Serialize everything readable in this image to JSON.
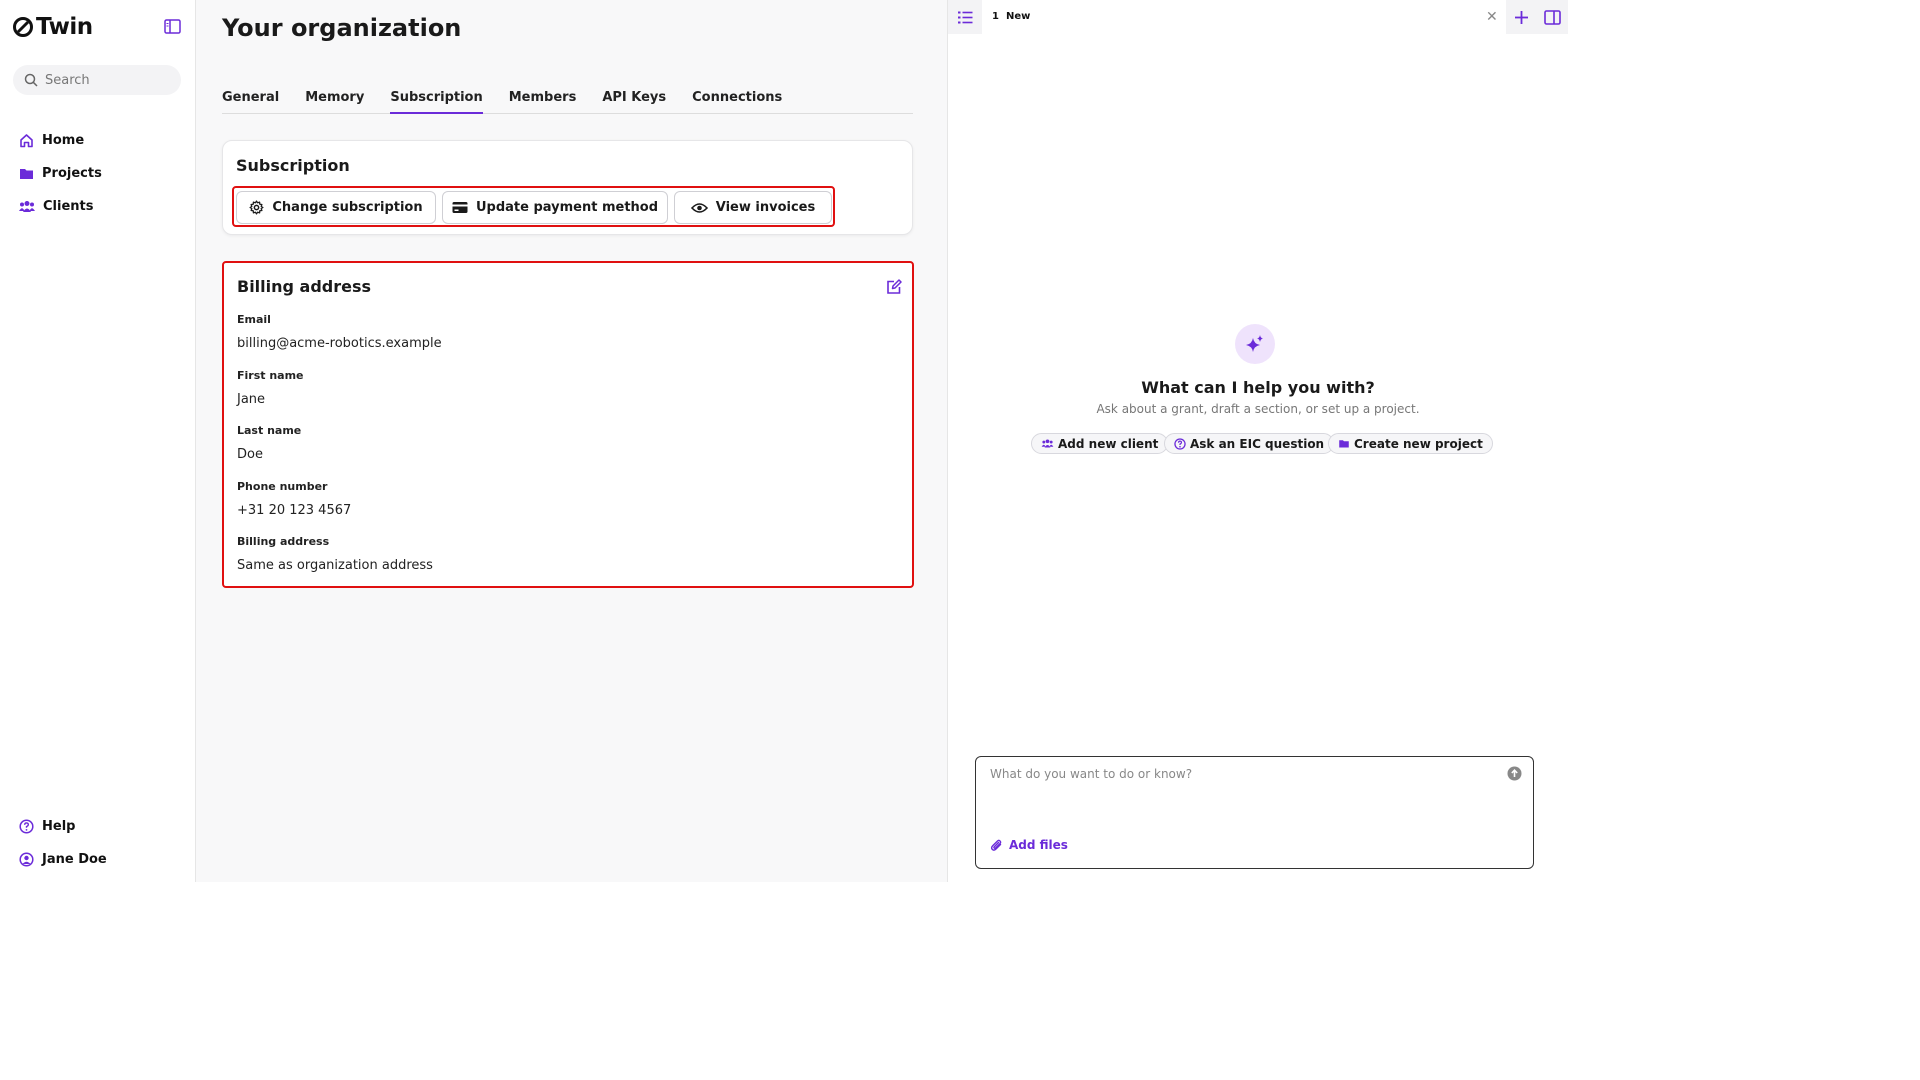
{
  "app": {
    "logo_text": "Twin"
  },
  "colors": {
    "accent": "#6b2bd9",
    "highlight_border": "#e01010"
  },
  "sidebar": {
    "search_placeholder": "Search",
    "items": [
      {
        "label": "Home",
        "icon": "home-icon"
      },
      {
        "label": "Projects",
        "icon": "folder-icon"
      },
      {
        "label": "Clients",
        "icon": "users-icon"
      }
    ],
    "bottom_items": [
      {
        "label": "Help",
        "icon": "help-icon"
      },
      {
        "label": "Jane Doe",
        "icon": "user-avatar-icon"
      }
    ]
  },
  "main": {
    "title": "Your organization",
    "tabs": [
      {
        "label": "General",
        "active": false
      },
      {
        "label": "Memory",
        "active": false
      },
      {
        "label": "Subscription",
        "active": true
      },
      {
        "label": "Members",
        "active": false
      },
      {
        "label": "API Keys",
        "active": false
      },
      {
        "label": "Connections",
        "active": false
      }
    ],
    "subscription": {
      "title": "Subscription",
      "buttons": {
        "change": "Change subscription",
        "payment": "Update payment method",
        "invoices": "View invoices"
      }
    },
    "billing": {
      "title": "Billing address",
      "fields": [
        {
          "label": "Email",
          "value": "billing@acme-robotics.example"
        },
        {
          "label": "First name",
          "value": "Jane"
        },
        {
          "label": "Last name",
          "value": "Doe"
        },
        {
          "label": "Phone number",
          "value": "+31 20 123 4567"
        },
        {
          "label": "Billing address",
          "value": "Same as organization address"
        }
      ]
    }
  },
  "panel": {
    "tab_number": "1",
    "tab_label": "New",
    "close_glyph": "✕",
    "assistant_title": "What can I help you with?",
    "assistant_subtitle": "Ask about a grant, draft a section, or set up a project.",
    "chips": {
      "add_client": "Add new client",
      "eic": "Ask an EIC question",
      "new_project": "Create new project"
    },
    "composer_placeholder": "What do you want to do or know?",
    "add_files": "Add files"
  }
}
